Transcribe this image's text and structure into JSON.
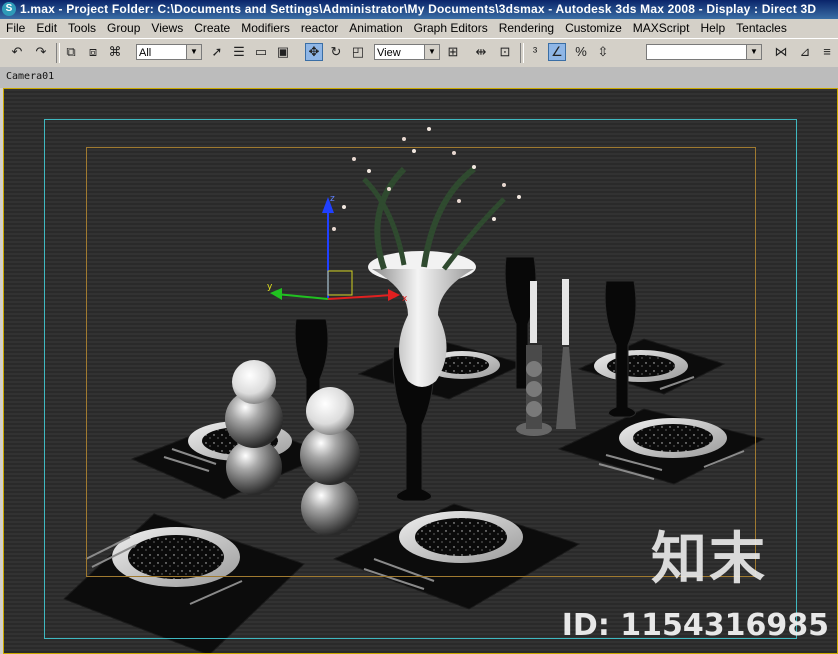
{
  "titlebar": {
    "title": "1.max    - Project Folder: C:\\Documents and Settings\\Administrator\\My Documents\\3dsmax    - Autodesk 3ds Max 2008    - Display : Direct 3D"
  },
  "menu": [
    "File",
    "Edit",
    "Tools",
    "Group",
    "Views",
    "Create",
    "Modifiers",
    "reactor",
    "Animation",
    "Graph Editors",
    "Rendering",
    "Customize",
    "MAXScript",
    "Help",
    "Tentacles"
  ],
  "toolbar": {
    "selection_filter": "All",
    "reference_coord": "View",
    "named_selection": ""
  },
  "viewport": {
    "label": "Camera01",
    "gizmo_axes": [
      "x",
      "y",
      "z"
    ]
  },
  "watermark": {
    "brand": "知末",
    "id": "ID: 1154316985"
  },
  "colors": {
    "title_bg": "#0a246a",
    "ui_face": "#d4d0c8",
    "viewport_border": "#c9a800",
    "safe_frame": "#3fb8c0",
    "action_frame": "#a07a30",
    "gizmo_x": "#e02020",
    "gizmo_y": "#20c020",
    "gizmo_z": "#2040ff"
  }
}
